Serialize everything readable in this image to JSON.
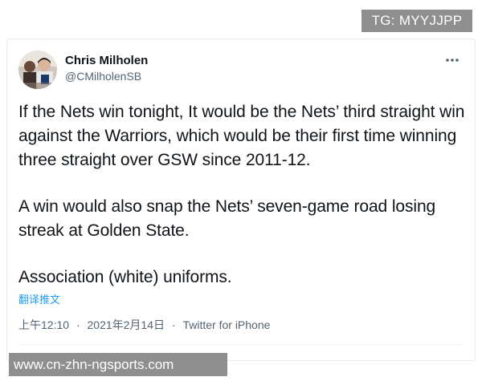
{
  "watermark_top": "TG: MYYJJPP",
  "tweet": {
    "author_name": "Chris Milholen",
    "author_handle": "@CMilholenSB",
    "paragraphs": [
      "If the Nets win tonight, It would be the Nets’ third straight win against the Warriors, which would be their first time winning three straight over GSW since 2011-12.",
      "A win would also snap the Nets’ seven-game road losing streak at Golden State.",
      "Association (white) uniforms."
    ],
    "translate_label": "翻译推文",
    "time": "上午12:10",
    "date": "2021年2月14日",
    "source": "Twitter for iPhone",
    "separator": "·",
    "more_icon": "ellipsis-icon"
  },
  "watermark_bottom": "www.cn-zhn-ngsports.com",
  "colors": {
    "text_primary": "#0f1419",
    "text_secondary": "#536471",
    "link": "#1d9bf0",
    "watermark_bg": "#8f8f8f"
  }
}
